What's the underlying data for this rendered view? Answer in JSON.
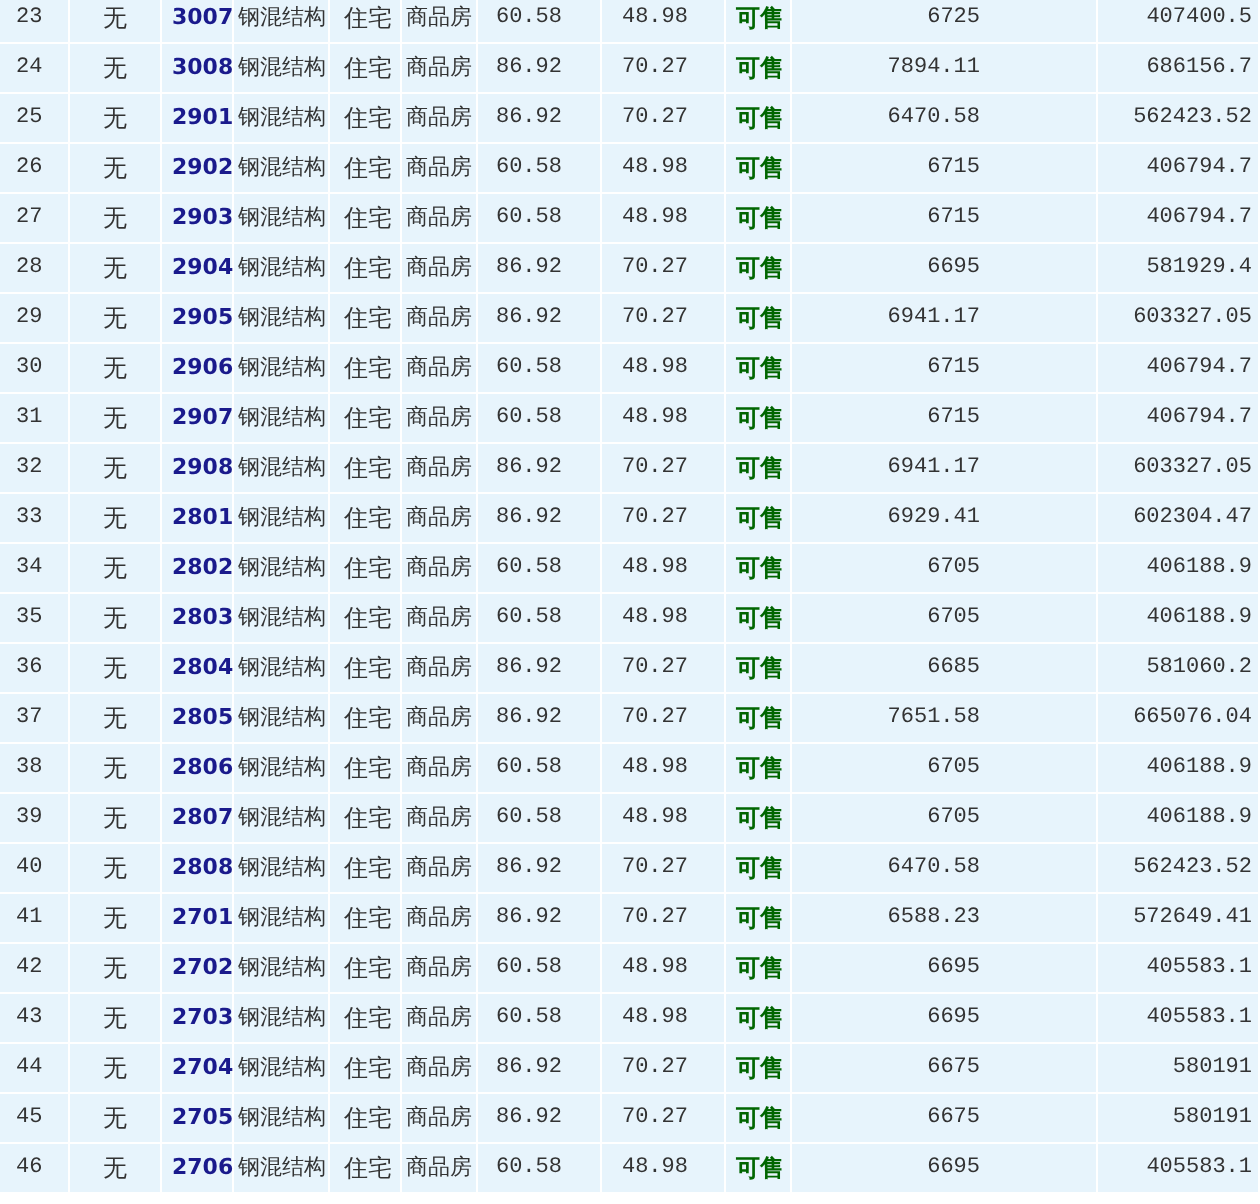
{
  "table": {
    "rows": [
      [
        "23",
        "无",
        "3007",
        "钢混结构",
        "住宅",
        "商品房",
        "60.58",
        "48.98",
        "可售",
        "6725",
        "407400.5"
      ],
      [
        "24",
        "无",
        "3008",
        "钢混结构",
        "住宅",
        "商品房",
        "86.92",
        "70.27",
        "可售",
        "7894.11",
        "686156.7"
      ],
      [
        "25",
        "无",
        "2901",
        "钢混结构",
        "住宅",
        "商品房",
        "86.92",
        "70.27",
        "可售",
        "6470.58",
        "562423.52"
      ],
      [
        "26",
        "无",
        "2902",
        "钢混结构",
        "住宅",
        "商品房",
        "60.58",
        "48.98",
        "可售",
        "6715",
        "406794.7"
      ],
      [
        "27",
        "无",
        "2903",
        "钢混结构",
        "住宅",
        "商品房",
        "60.58",
        "48.98",
        "可售",
        "6715",
        "406794.7"
      ],
      [
        "28",
        "无",
        "2904",
        "钢混结构",
        "住宅",
        "商品房",
        "86.92",
        "70.27",
        "可售",
        "6695",
        "581929.4"
      ],
      [
        "29",
        "无",
        "2905",
        "钢混结构",
        "住宅",
        "商品房",
        "86.92",
        "70.27",
        "可售",
        "6941.17",
        "603327.05"
      ],
      [
        "30",
        "无",
        "2906",
        "钢混结构",
        "住宅",
        "商品房",
        "60.58",
        "48.98",
        "可售",
        "6715",
        "406794.7"
      ],
      [
        "31",
        "无",
        "2907",
        "钢混结构",
        "住宅",
        "商品房",
        "60.58",
        "48.98",
        "可售",
        "6715",
        "406794.7"
      ],
      [
        "32",
        "无",
        "2908",
        "钢混结构",
        "住宅",
        "商品房",
        "86.92",
        "70.27",
        "可售",
        "6941.17",
        "603327.05"
      ],
      [
        "33",
        "无",
        "2801",
        "钢混结构",
        "住宅",
        "商品房",
        "86.92",
        "70.27",
        "可售",
        "6929.41",
        "602304.47"
      ],
      [
        "34",
        "无",
        "2802",
        "钢混结构",
        "住宅",
        "商品房",
        "60.58",
        "48.98",
        "可售",
        "6705",
        "406188.9"
      ],
      [
        "35",
        "无",
        "2803",
        "钢混结构",
        "住宅",
        "商品房",
        "60.58",
        "48.98",
        "可售",
        "6705",
        "406188.9"
      ],
      [
        "36",
        "无",
        "2804",
        "钢混结构",
        "住宅",
        "商品房",
        "86.92",
        "70.27",
        "可售",
        "6685",
        "581060.2"
      ],
      [
        "37",
        "无",
        "2805",
        "钢混结构",
        "住宅",
        "商品房",
        "86.92",
        "70.27",
        "可售",
        "7651.58",
        "665076.04"
      ],
      [
        "38",
        "无",
        "2806",
        "钢混结构",
        "住宅",
        "商品房",
        "60.58",
        "48.98",
        "可售",
        "6705",
        "406188.9"
      ],
      [
        "39",
        "无",
        "2807",
        "钢混结构",
        "住宅",
        "商品房",
        "60.58",
        "48.98",
        "可售",
        "6705",
        "406188.9"
      ],
      [
        "40",
        "无",
        "2808",
        "钢混结构",
        "住宅",
        "商品房",
        "86.92",
        "70.27",
        "可售",
        "6470.58",
        "562423.52"
      ],
      [
        "41",
        "无",
        "2701",
        "钢混结构",
        "住宅",
        "商品房",
        "86.92",
        "70.27",
        "可售",
        "6588.23",
        "572649.41"
      ],
      [
        "42",
        "无",
        "2702",
        "钢混结构",
        "住宅",
        "商品房",
        "60.58",
        "48.98",
        "可售",
        "6695",
        "405583.1"
      ],
      [
        "43",
        "无",
        "2703",
        "钢混结构",
        "住宅",
        "商品房",
        "60.58",
        "48.98",
        "可售",
        "6695",
        "405583.1"
      ],
      [
        "44",
        "无",
        "2704",
        "钢混结构",
        "住宅",
        "商品房",
        "86.92",
        "70.27",
        "可售",
        "6675",
        "580191"
      ],
      [
        "45",
        "无",
        "2705",
        "钢混结构",
        "住宅",
        "商品房",
        "86.92",
        "70.27",
        "可售",
        "6675",
        "580191"
      ],
      [
        "46",
        "无",
        "2706",
        "钢混结构",
        "住宅",
        "商品房",
        "60.58",
        "48.98",
        "可售",
        "6695",
        "405583.1"
      ]
    ]
  }
}
